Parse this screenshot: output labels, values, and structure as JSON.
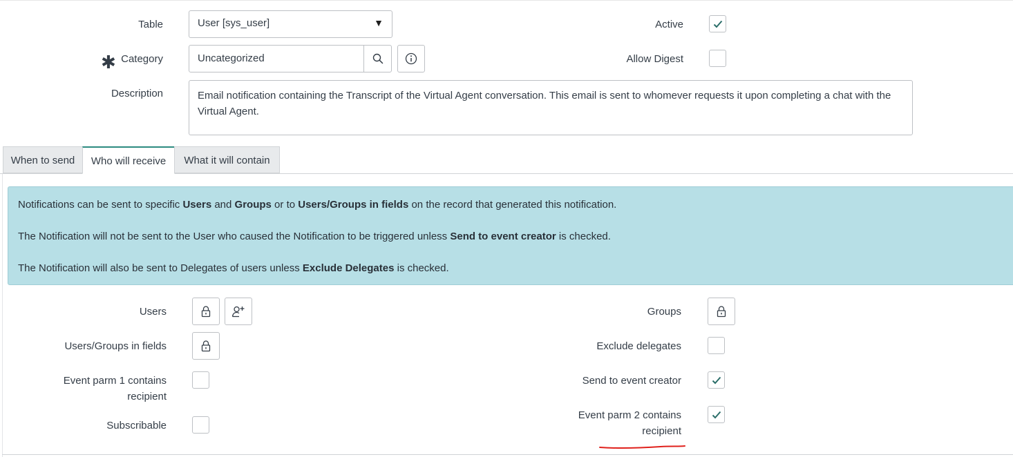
{
  "form": {
    "table": {
      "label": "Table",
      "value": "User [sys_user]",
      "arrow": "▼"
    },
    "category": {
      "label": "Category",
      "value": "Uncategorized"
    },
    "description": {
      "label": "Description",
      "value": "Email notification containing the Transcript of the Virtual Agent conversation. This email is sent to whomever requests it upon completing a chat with the Virtual Agent."
    },
    "active": {
      "label": "Active",
      "checked": true
    },
    "allow_digest": {
      "label": "Allow Digest",
      "checked": false
    }
  },
  "tabs": [
    {
      "label": "When to send",
      "active": false
    },
    {
      "label": "Who will receive",
      "active": true
    },
    {
      "label": "What it will contain",
      "active": false
    }
  ],
  "info": {
    "line1": {
      "t1": "Notifications can be sent to specific ",
      "b1": "Users",
      "t2": " and ",
      "b2": "Groups",
      "t3": " or to ",
      "b3": "Users/Groups in fields",
      "t4": " on the record that generated this notification."
    },
    "line2": {
      "t1": "The Notification will not be sent to the User who caused the Notification to be triggered unless ",
      "b1": "Send to event creator",
      "t2": " is checked."
    },
    "line3": {
      "t1": "The Notification will also be sent to Delegates of users unless ",
      "b1": "Exclude Delegates",
      "t2": " is checked."
    }
  },
  "recipients": {
    "users": {
      "label": "Users"
    },
    "users_groups_in_fields": {
      "label": "Users/Groups in fields"
    },
    "event_parm1": {
      "label_line1": "Event parm 1 contains",
      "label_line2": "recipient",
      "checked": false
    },
    "subscribable": {
      "label": "Subscribable",
      "checked": false
    },
    "groups": {
      "label": "Groups"
    },
    "exclude_delegates": {
      "label": "Exclude delegates",
      "checked": false
    },
    "send_to_event_creator": {
      "label": "Send to event creator",
      "checked": true
    },
    "event_parm2": {
      "label_line1": "Event parm 2 contains",
      "label_line2": "recipient",
      "checked": true
    }
  },
  "colors": {
    "check": "#2b6e69",
    "info_bg": "#b7dfe6",
    "annotation": "#e0201b"
  },
  "icons": {
    "search": "search-icon",
    "info": "info-icon",
    "lock": "lock-icon",
    "add_me": "add-me-icon",
    "check": "checkmark-icon"
  }
}
